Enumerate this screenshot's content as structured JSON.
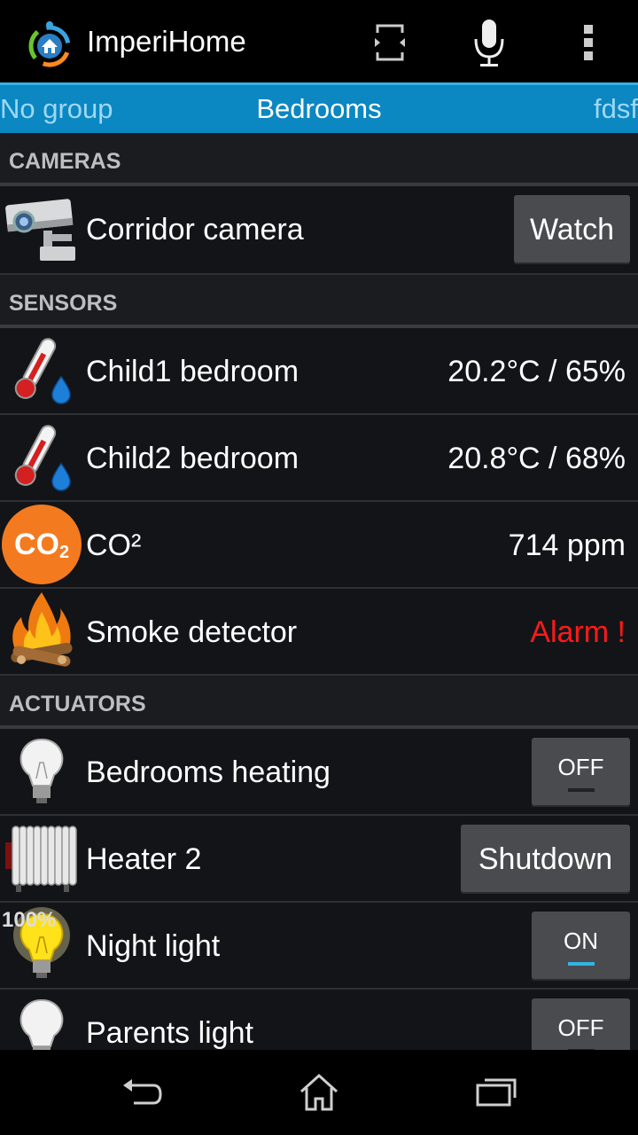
{
  "app": {
    "title": "ImperiHome"
  },
  "actionbar": {
    "icons": [
      "rotate-icon",
      "microphone-icon",
      "overflow-menu-icon"
    ]
  },
  "tabs": {
    "left": "No group",
    "center": "Bedrooms",
    "right": "fdsf"
  },
  "sections": {
    "cameras": "CAMERAS",
    "sensors": "SENSORS",
    "actuators": "ACTUATORS"
  },
  "cameras": [
    {
      "label": "Corridor camera",
      "button": "Watch",
      "icon": "security-camera-icon"
    }
  ],
  "sensors": [
    {
      "label": "Child1 bedroom",
      "value": "20.2°C / 65%",
      "icon": "thermometer-humidity-icon"
    },
    {
      "label": "Child2 bedroom",
      "value": "20.8°C / 68%",
      "icon": "thermometer-humidity-icon"
    },
    {
      "label": "CO²",
      "value": "714 ppm",
      "icon": "co2-icon",
      "icon_text": "CO",
      "icon_sub": "2"
    },
    {
      "label": "Smoke detector",
      "value": "Alarm !",
      "icon": "fire-icon"
    }
  ],
  "actuators": [
    {
      "label": "Bedrooms heating",
      "button": "OFF",
      "state": "off",
      "icon": "light-bulb-icon"
    },
    {
      "label": "Heater 2",
      "button": "Shutdown",
      "icon": "radiator-icon"
    },
    {
      "label": "Night light",
      "button": "ON",
      "state": "on",
      "level": "100%",
      "icon": "light-bulb-lit-icon"
    },
    {
      "label": "Parents light",
      "button": "OFF",
      "state": "off",
      "icon": "light-bulb-icon"
    }
  ],
  "colors": {
    "accent": "#33b5e5",
    "tabs_bg": "#0b87c2",
    "alarm": "#ff1a1a",
    "co2": "#f47a20"
  },
  "navbar": {
    "icons": [
      "back-icon",
      "home-icon",
      "recent-apps-icon"
    ]
  }
}
